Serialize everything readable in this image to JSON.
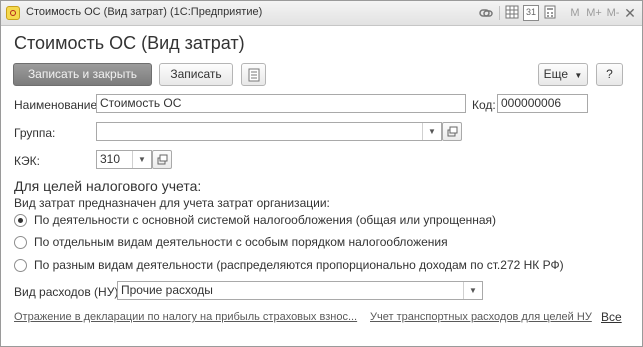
{
  "window": {
    "title": "Стоимость ОС (Вид затрат)  (1С:Предприятие)",
    "toolbar": {
      "m": "M",
      "m_plus": "M+",
      "m_minus": "M-",
      "calendar_day": "31",
      "close": "✕"
    }
  },
  "form": {
    "heading": "Стоимость ОС (Вид затрат)",
    "buttons": {
      "save_close": "Записать и закрыть",
      "save": "Записать",
      "more": "Еще",
      "help": "?"
    },
    "fields": {
      "name_label": "Наименование:",
      "name_value": "Стоимость ОС",
      "code_label": "Код:",
      "code_value": "000000006",
      "group_label": "Группа:",
      "group_value": "",
      "kek_label": "КЭК:",
      "kek_value": "310"
    },
    "tax": {
      "section_title": "Для целей налогового учета:",
      "subtitle": "Вид затрат предназначен для учета затрат организации:",
      "options": [
        {
          "label": "По деятельности с основной системой налогообложения (общая или упрощенная)",
          "selected": true
        },
        {
          "label": "По отдельным видам деятельности с особым порядком налогообложения",
          "selected": false
        },
        {
          "label": "По разным видам деятельности (распределяются пропорционально доходам по ст.272 НК РФ)",
          "selected": false
        }
      ],
      "expense_type_label": "Вид расходов (НУ):",
      "expense_type_value": "Прочие расходы"
    },
    "links": {
      "declaration": "Отражение в декларации по налогу на прибыль страховых взнос...",
      "transport": "Учет транспортных расходов для целей НУ",
      "all": "Все"
    }
  }
}
